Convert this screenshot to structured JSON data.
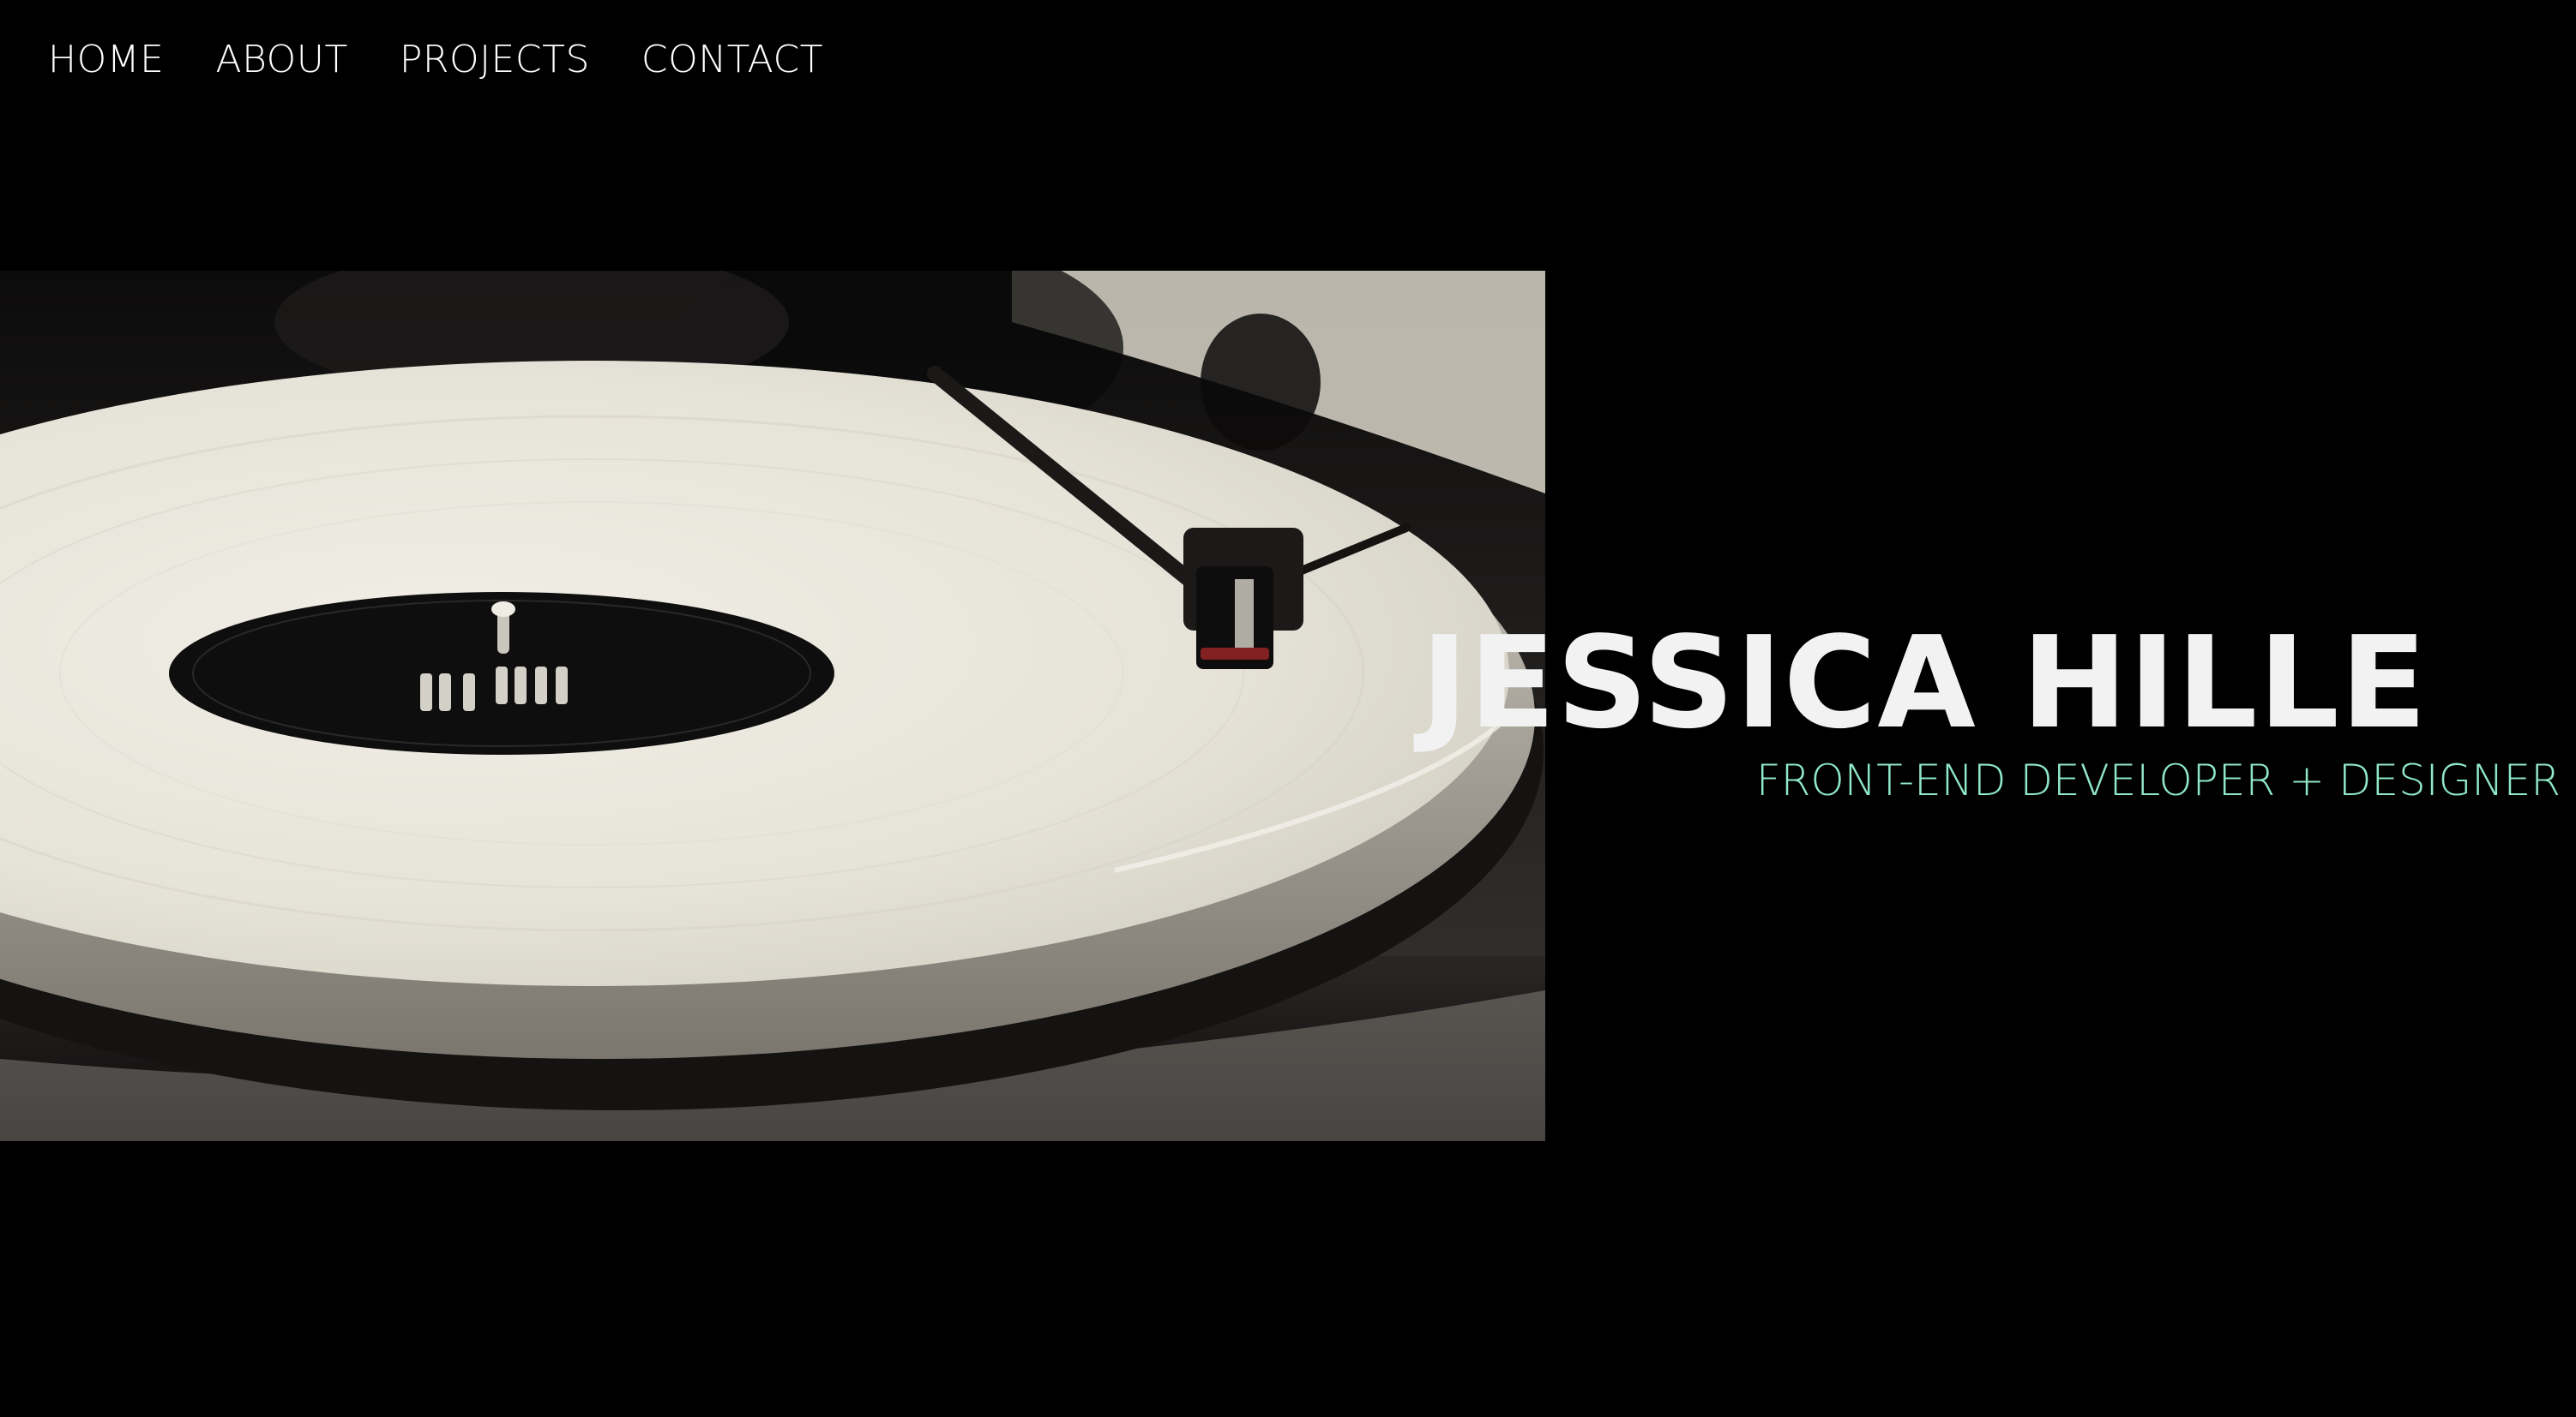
{
  "nav": {
    "items": [
      {
        "label": "HOME"
      },
      {
        "label": "ABOUT"
      },
      {
        "label": "PROJECTS"
      },
      {
        "label": "CONTACT"
      }
    ]
  },
  "hero": {
    "name": "JESSICA HILLE",
    "title": "FRONT-END DEVELOPER + DESIGNER",
    "image_alt": "turntable-photo"
  },
  "colors": {
    "background": "#000000",
    "name_text": "#f2f2f2",
    "title_accent": "#8fe8c6"
  }
}
